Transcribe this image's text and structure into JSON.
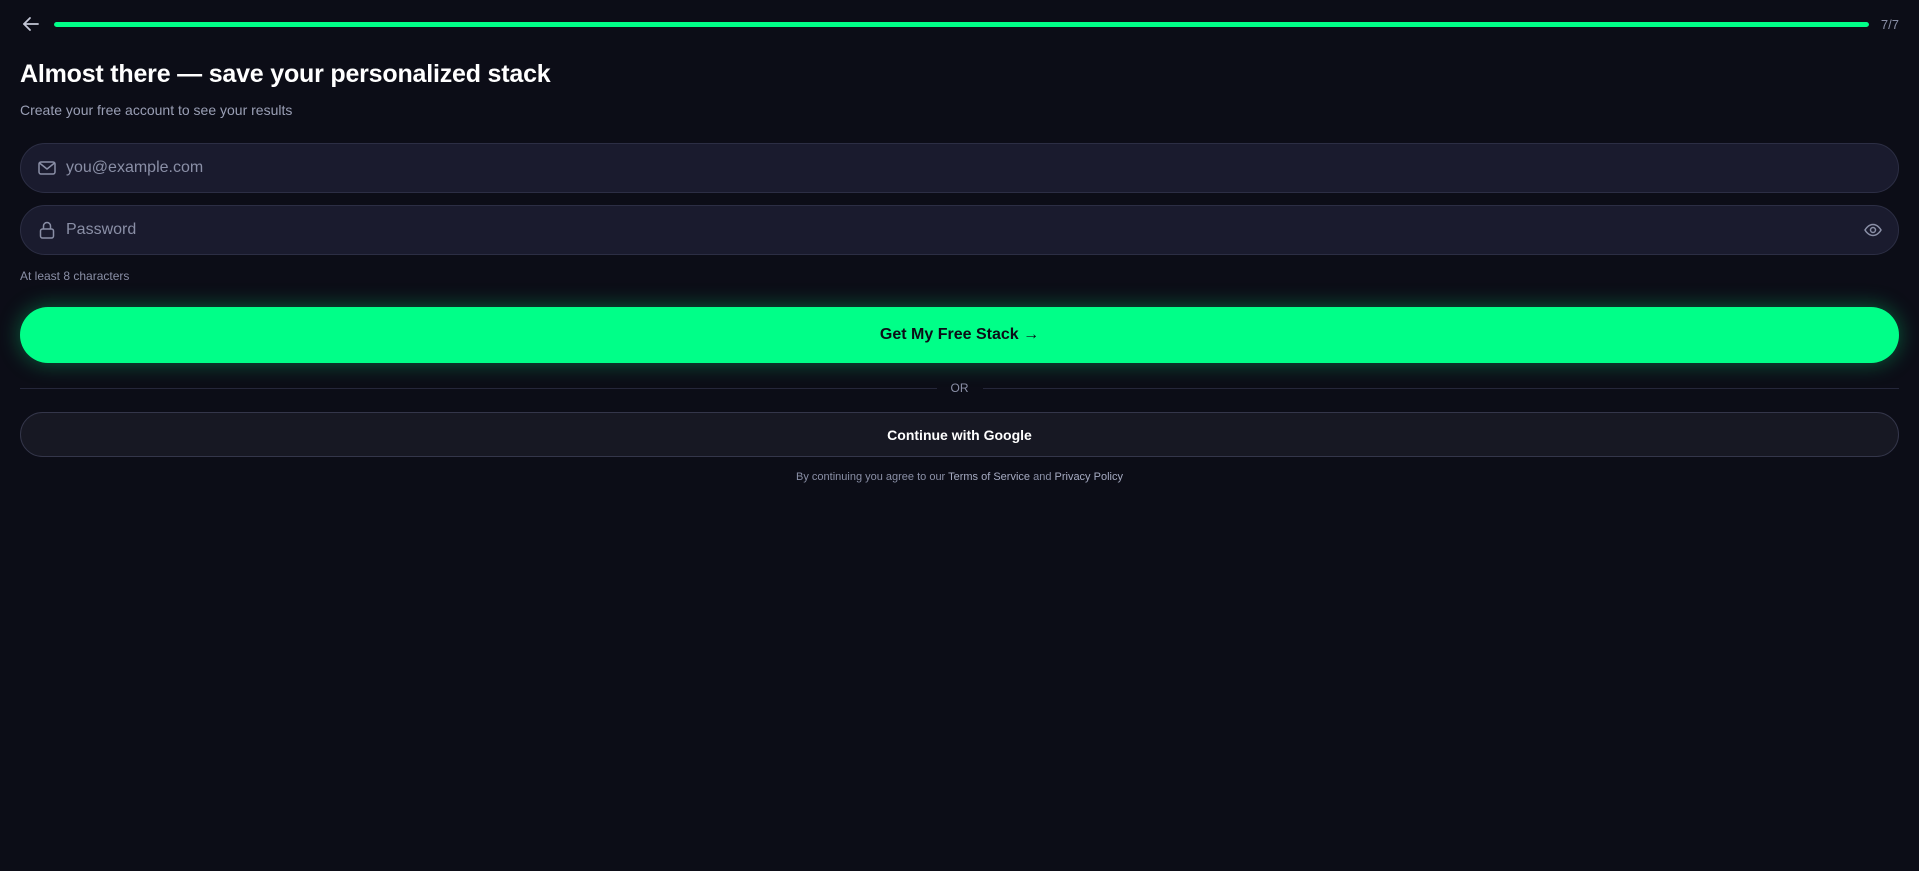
{
  "header": {
    "back_icon": "arrow-left-icon",
    "progress": 1.0,
    "step_count": "7/7"
  },
  "title": "Almost there — save your personalized stack",
  "subtitle": "Create your free account to see your results",
  "form": {
    "email": {
      "icon": "mail-icon",
      "value": "",
      "placeholder": "you@example.com"
    },
    "password": {
      "icon": "lock-icon",
      "value": "",
      "placeholder": "Password",
      "toggle_icon": "eye-icon"
    },
    "hint": "At least 8 characters"
  },
  "primary_button": {
    "label": "Get My Free Stack →"
  },
  "divider_label": "OR",
  "google_button": {
    "label": "Continue with Google"
  },
  "legal": {
    "prefix": "By continuing you agree to our",
    "terms": "Terms of Service",
    "and": "and",
    "privacy": "Privacy Policy"
  },
  "colors": {
    "background": "#0c0d17",
    "accent": "#00ff88",
    "field_bg": "#1a1b2e",
    "muted_text": "#8a8fa6"
  }
}
